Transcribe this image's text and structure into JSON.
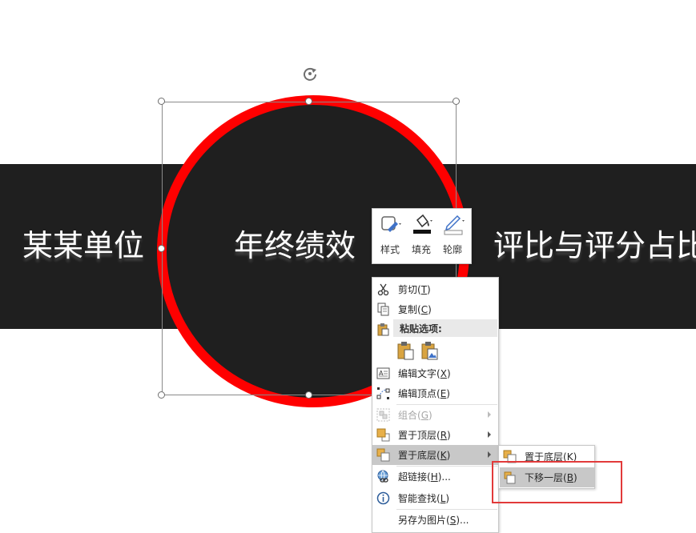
{
  "slide": {
    "band_texts": [
      "某某单位",
      "年终绩效",
      "评比与评分占比"
    ],
    "colors": {
      "band": "#1f1f1f",
      "circle_fill": "#1f1f1f",
      "circle_border": "#ff0000",
      "text": "#ffffff"
    }
  },
  "mini_toolbar": {
    "buttons": [
      {
        "label": "样式",
        "icon": "shape-style-icon"
      },
      {
        "label": "填充",
        "icon": "fill-bucket-icon"
      },
      {
        "label": "轮廓",
        "icon": "outline-pen-icon"
      }
    ]
  },
  "context_menu": {
    "items": [
      {
        "label": "剪切",
        "key": "T",
        "icon": "scissors-icon"
      },
      {
        "label": "复制",
        "key": "C",
        "icon": "copy-icon"
      },
      {
        "label": "粘贴选项:",
        "icon": "paste-icon",
        "type": "header"
      },
      {
        "label": "编辑文字",
        "key": "X",
        "icon": "edit-text-icon"
      },
      {
        "label": "编辑顶点",
        "key": "E",
        "icon": "edit-points-icon"
      },
      {
        "label": "组合",
        "key": "G",
        "icon": "group-icon",
        "disabled": true,
        "submenu": true
      },
      {
        "label": "置于顶层",
        "key": "R",
        "icon": "bring-to-front-icon",
        "submenu": true
      },
      {
        "label": "置于底层",
        "key": "K",
        "icon": "send-to-back-icon",
        "submenu": true,
        "highlighted": true
      },
      {
        "label": "超链接",
        "key": "H",
        "suffix": "...",
        "icon": "hyperlink-icon"
      },
      {
        "label": "智能查找",
        "key": "L",
        "icon": "smart-lookup-icon"
      },
      {
        "label": "另存为图片",
        "key": "S",
        "suffix": "...",
        "icon": ""
      }
    ]
  },
  "submenu": {
    "items": [
      {
        "label": "置于底层",
        "key": "K",
        "icon": "send-to-back-icon"
      },
      {
        "label": "下移一层",
        "key": "B",
        "icon": "send-backward-icon",
        "highlighted": true
      }
    ]
  }
}
